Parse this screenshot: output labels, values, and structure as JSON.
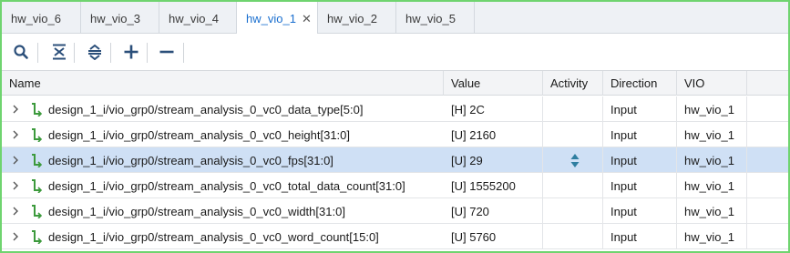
{
  "tabs": [
    {
      "label": "hw_vio_6",
      "active": false
    },
    {
      "label": "hw_vio_3",
      "active": false
    },
    {
      "label": "hw_vio_4",
      "active": false
    },
    {
      "label": "hw_vio_1",
      "active": true,
      "closable": true
    },
    {
      "label": "hw_vio_2",
      "active": false
    },
    {
      "label": "hw_vio_5",
      "active": false
    }
  ],
  "toolbar": {
    "buttons": [
      "search-icon",
      "collapse-all-icon",
      "expand-all-icon",
      "add-icon",
      "remove-icon"
    ]
  },
  "colors": {
    "active_tab_text": "#1a6fcf",
    "frame_border": "#6fd46f",
    "selected_row": "#cfe0f5",
    "signal_icon": "#3c9a3c"
  },
  "table": {
    "columns": [
      "Name",
      "Value",
      "Activity",
      "Direction",
      "VIO"
    ],
    "rows": [
      {
        "name": "design_1_i/vio_grp0/stream_analysis_0_vc0_data_type[5:0]",
        "value": "[H] 2C",
        "activity": "",
        "direction": "Input",
        "vio": "hw_vio_1",
        "selected": false
      },
      {
        "name": "design_1_i/vio_grp0/stream_analysis_0_vc0_height[31:0]",
        "value": "[U] 2160",
        "activity": "",
        "direction": "Input",
        "vio": "hw_vio_1",
        "selected": false
      },
      {
        "name": "design_1_i/vio_grp0/stream_analysis_0_vc0_fps[31:0]",
        "value": "[U] 29",
        "activity": "up-down-arrow-icon",
        "direction": "Input",
        "vio": "hw_vio_1",
        "selected": true
      },
      {
        "name": "design_1_i/vio_grp0/stream_analysis_0_vc0_total_data_count[31:0]",
        "value": "[U] 1555200",
        "activity": "",
        "direction": "Input",
        "vio": "hw_vio_1",
        "selected": false
      },
      {
        "name": "design_1_i/vio_grp0/stream_analysis_0_vc0_width[31:0]",
        "value": "[U] 720",
        "activity": "",
        "direction": "Input",
        "vio": "hw_vio_1",
        "selected": false
      },
      {
        "name": "design_1_i/vio_grp0/stream_analysis_0_vc0_word_count[15:0]",
        "value": "[U] 5760",
        "activity": "",
        "direction": "Input",
        "vio": "hw_vio_1",
        "selected": false
      }
    ]
  }
}
